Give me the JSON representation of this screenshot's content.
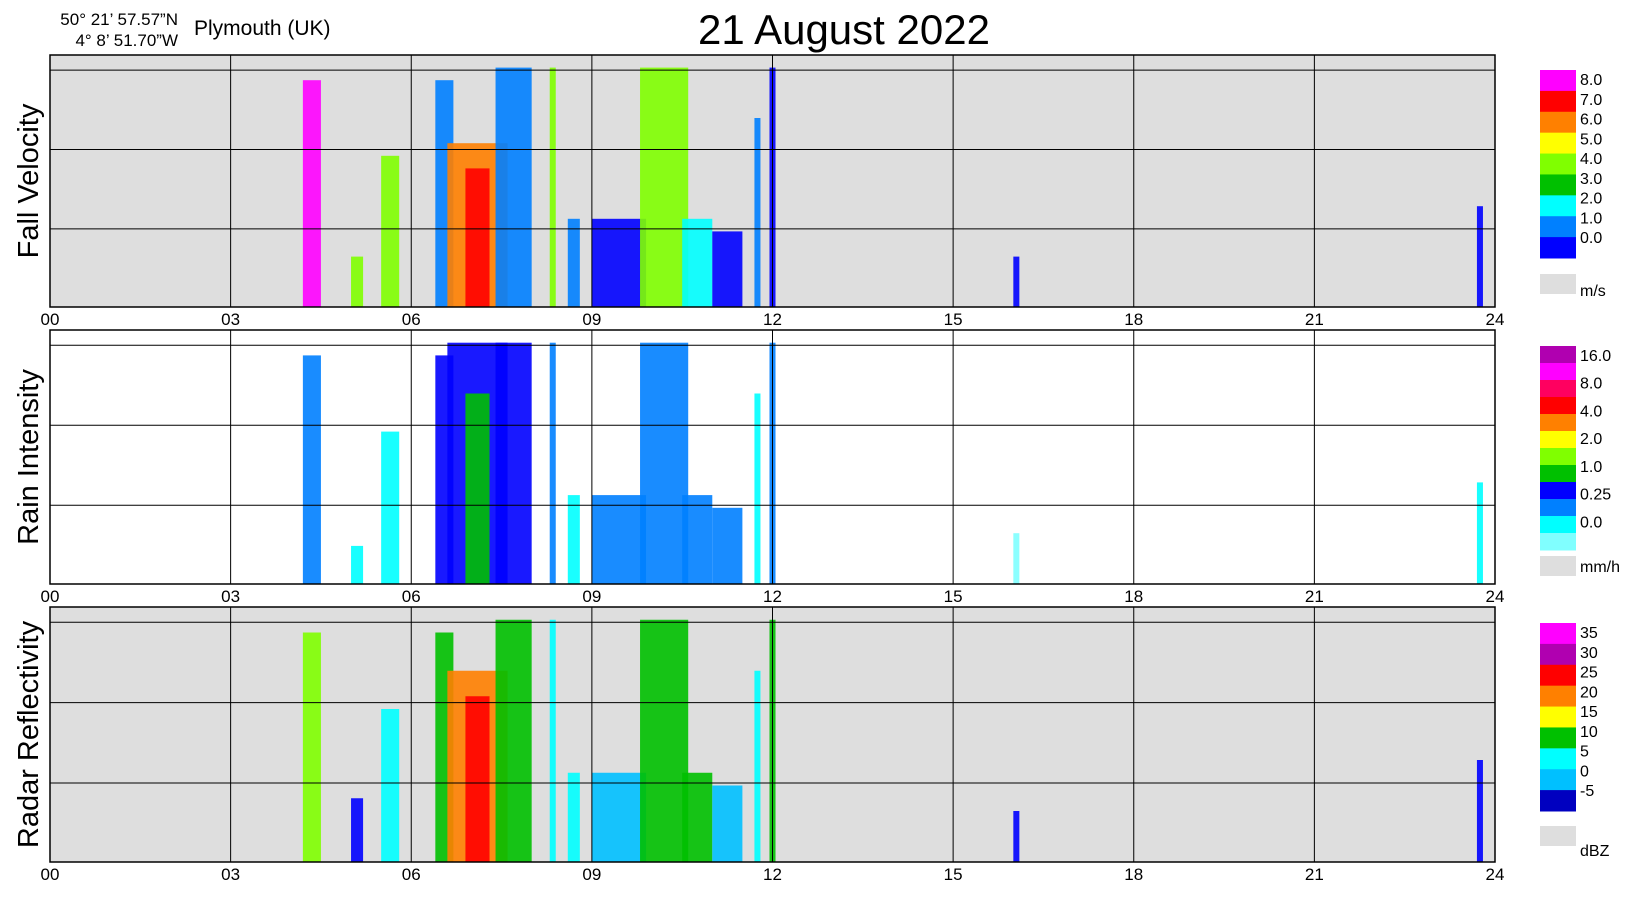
{
  "header": {
    "latitude": "50° 21’ 57.57”N",
    "longitude": "4°  8’ 51.70”W",
    "location": "Plymouth (UK)",
    "title": "21 August  2022"
  },
  "chart_data": [
    {
      "type": "heatmap",
      "ylabel": "Fall Velocity",
      "background": "#dedede",
      "x_ticks": [
        "00",
        "03",
        "06",
        "09",
        "12",
        "15",
        "18",
        "21",
        "24"
      ],
      "xlim": [
        0,
        24
      ],
      "unit": "m/s",
      "legend": {
        "labels": [
          "8.0",
          "7.0",
          "6.0",
          "5.0",
          "4.0",
          "3.0",
          "2.0",
          "1.0",
          "0.0"
        ],
        "colors": [
          "#ff00ff",
          "#ff0000",
          "#ff8000",
          "#ffff00",
          "#80ff00",
          "#00c000",
          "#00ffff",
          "#0080ff",
          "#0000ff"
        ]
      },
      "events": [
        {
          "start": 4.2,
          "end": 4.5,
          "level": 0.9,
          "color": "#ff00ff"
        },
        {
          "start": 5.0,
          "end": 5.2,
          "level": 0.2,
          "color": "#80ff00"
        },
        {
          "start": 5.5,
          "end": 5.8,
          "level": 0.6,
          "color": "#80ff00"
        },
        {
          "start": 6.4,
          "end": 6.7,
          "level": 0.9,
          "color": "#0080ff"
        },
        {
          "start": 6.6,
          "end": 7.6,
          "level": 0.65,
          "color": "#ff8000"
        },
        {
          "start": 6.9,
          "end": 7.3,
          "level": 0.55,
          "color": "#ff0000"
        },
        {
          "start": 7.4,
          "end": 8.0,
          "level": 0.95,
          "color": "#0080ff"
        },
        {
          "start": 8.3,
          "end": 8.4,
          "level": 0.95,
          "color": "#80ff00"
        },
        {
          "start": 8.6,
          "end": 8.8,
          "level": 0.35,
          "color": "#0080ff"
        },
        {
          "start": 9.0,
          "end": 9.9,
          "level": 0.35,
          "color": "#0000ff"
        },
        {
          "start": 9.8,
          "end": 10.6,
          "level": 0.95,
          "color": "#80ff00"
        },
        {
          "start": 10.5,
          "end": 11.0,
          "level": 0.35,
          "color": "#00ffff"
        },
        {
          "start": 11.0,
          "end": 11.5,
          "level": 0.3,
          "color": "#0000ff"
        },
        {
          "start": 11.7,
          "end": 11.8,
          "level": 0.75,
          "color": "#0080ff"
        },
        {
          "start": 11.95,
          "end": 12.05,
          "level": 0.95,
          "color": "#0000ff"
        },
        {
          "start": 16.0,
          "end": 16.1,
          "level": 0.2,
          "color": "#0000ff"
        },
        {
          "start": 23.7,
          "end": 23.8,
          "level": 0.4,
          "color": "#0000ff"
        }
      ]
    },
    {
      "type": "heatmap",
      "ylabel": "Rain Intensity",
      "background": "#ffffff",
      "x_ticks": [
        "00",
        "03",
        "06",
        "09",
        "12",
        "15",
        "18",
        "21",
        "24"
      ],
      "xlim": [
        0,
        24
      ],
      "unit": "mm/h",
      "legend": {
        "labels": [
          "16.0",
          "8.0",
          "4.0",
          "2.0",
          "1.0",
          "0.25",
          "0.0"
        ],
        "colors": [
          "#b000b0",
          "#ff00ff",
          "#ff0060",
          "#ff0000",
          "#ff8000",
          "#ffff00",
          "#80ff00",
          "#00c000",
          "#0000ff",
          "#0080ff",
          "#00ffff",
          "#80ffff"
        ]
      },
      "events": [
        {
          "start": 4.2,
          "end": 4.5,
          "level": 0.9,
          "color": "#0080ff"
        },
        {
          "start": 5.0,
          "end": 5.2,
          "level": 0.15,
          "color": "#00ffff"
        },
        {
          "start": 5.5,
          "end": 5.8,
          "level": 0.6,
          "color": "#00ffff"
        },
        {
          "start": 6.4,
          "end": 6.7,
          "level": 0.9,
          "color": "#0000ff"
        },
        {
          "start": 6.6,
          "end": 7.6,
          "level": 0.95,
          "color": "#0000ff"
        },
        {
          "start": 6.9,
          "end": 7.3,
          "level": 0.75,
          "color": "#00c000"
        },
        {
          "start": 7.4,
          "end": 8.0,
          "level": 0.95,
          "color": "#0000ff"
        },
        {
          "start": 8.3,
          "end": 8.4,
          "level": 0.95,
          "color": "#0080ff"
        },
        {
          "start": 8.6,
          "end": 8.8,
          "level": 0.35,
          "color": "#00ffff"
        },
        {
          "start": 9.0,
          "end": 9.9,
          "level": 0.35,
          "color": "#0080ff"
        },
        {
          "start": 9.8,
          "end": 10.6,
          "level": 0.95,
          "color": "#0080ff"
        },
        {
          "start": 10.5,
          "end": 11.0,
          "level": 0.35,
          "color": "#0080ff"
        },
        {
          "start": 11.0,
          "end": 11.5,
          "level": 0.3,
          "color": "#0080ff"
        },
        {
          "start": 11.7,
          "end": 11.8,
          "level": 0.75,
          "color": "#00ffff"
        },
        {
          "start": 11.95,
          "end": 12.05,
          "level": 0.95,
          "color": "#0080ff"
        },
        {
          "start": 16.0,
          "end": 16.1,
          "level": 0.2,
          "color": "#80ffff"
        },
        {
          "start": 23.7,
          "end": 23.8,
          "level": 0.4,
          "color": "#00ffff"
        }
      ]
    },
    {
      "type": "heatmap",
      "ylabel": "Radar Reflectivity",
      "background": "#dedede",
      "x_ticks": [
        "00",
        "03",
        "06",
        "09",
        "12",
        "15",
        "18",
        "21",
        "24"
      ],
      "xlim": [
        0,
        24
      ],
      "unit": "dBZ",
      "legend": {
        "labels": [
          "35",
          "30",
          "25",
          "20",
          "15",
          "10",
          "5",
          "0",
          "-5"
        ],
        "colors": [
          "#ff00ff",
          "#b000b0",
          "#ff0000",
          "#ff8000",
          "#ffff00",
          "#00c000",
          "#00ffff",
          "#00c0ff",
          "#0000c0"
        ]
      },
      "events": [
        {
          "start": 4.2,
          "end": 4.5,
          "level": 0.9,
          "color": "#80ff00"
        },
        {
          "start": 5.0,
          "end": 5.2,
          "level": 0.25,
          "color": "#0000ff"
        },
        {
          "start": 5.5,
          "end": 5.8,
          "level": 0.6,
          "color": "#00ffff"
        },
        {
          "start": 6.4,
          "end": 6.7,
          "level": 0.9,
          "color": "#00c000"
        },
        {
          "start": 6.6,
          "end": 7.6,
          "level": 0.75,
          "color": "#ff8000"
        },
        {
          "start": 6.9,
          "end": 7.3,
          "level": 0.65,
          "color": "#ff0000"
        },
        {
          "start": 7.4,
          "end": 8.0,
          "level": 0.95,
          "color": "#00c000"
        },
        {
          "start": 8.3,
          "end": 8.4,
          "level": 0.95,
          "color": "#00ffff"
        },
        {
          "start": 8.6,
          "end": 8.8,
          "level": 0.35,
          "color": "#00ffff"
        },
        {
          "start": 9.0,
          "end": 9.9,
          "level": 0.35,
          "color": "#00c0ff"
        },
        {
          "start": 9.8,
          "end": 10.6,
          "level": 0.95,
          "color": "#00c000"
        },
        {
          "start": 10.5,
          "end": 11.0,
          "level": 0.35,
          "color": "#00c000"
        },
        {
          "start": 11.0,
          "end": 11.5,
          "level": 0.3,
          "color": "#00c0ff"
        },
        {
          "start": 11.7,
          "end": 11.8,
          "level": 0.75,
          "color": "#00ffff"
        },
        {
          "start": 11.95,
          "end": 12.05,
          "level": 0.95,
          "color": "#00c000"
        },
        {
          "start": 16.0,
          "end": 16.1,
          "level": 0.2,
          "color": "#0000ff"
        },
        {
          "start": 23.7,
          "end": 23.8,
          "level": 0.4,
          "color": "#0000ff"
        }
      ]
    }
  ]
}
